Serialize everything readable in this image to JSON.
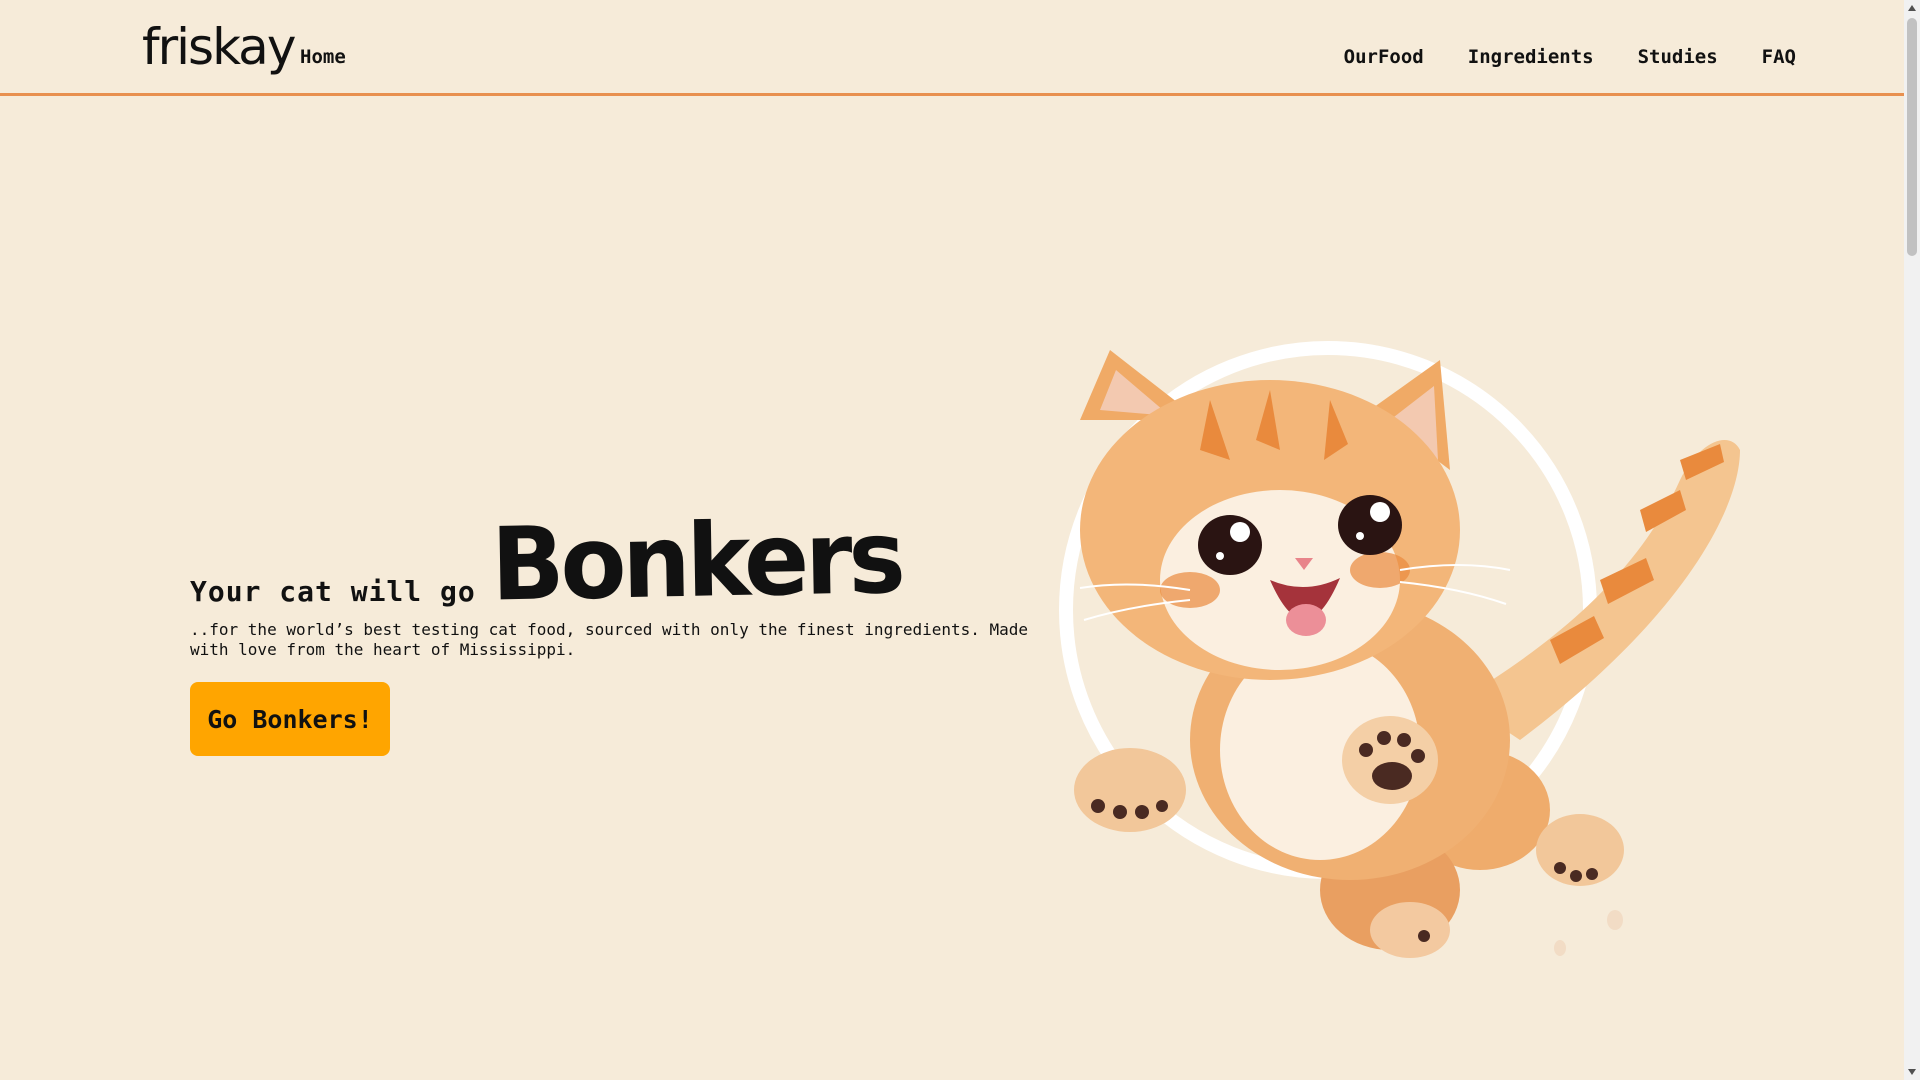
{
  "header": {
    "brand": "friskay",
    "home_label": "Home",
    "nav": [
      {
        "label": "OurFood"
      },
      {
        "label": "Ingredients"
      },
      {
        "label": "Studies"
      },
      {
        "label": "FAQ"
      }
    ]
  },
  "hero": {
    "lead": "Your cat will go",
    "highlight": "Bonkers",
    "tagline": "..for the world’s best testing cat food, sourced with only the finest ingredients. Made with love from the heart of Mississippi.",
    "cta_label": "Go Bonkers!"
  },
  "colors": {
    "background": "#f6ebd9",
    "header_border": "#e8904f",
    "cta": "#ffa500",
    "cat_fur": "#f2a866",
    "cat_stripes": "#e98a3d",
    "ring": "#ffffff"
  },
  "icons": {
    "illustration": "jumping-kitten-illustration",
    "scroll_up": "scroll-up-arrow-icon",
    "scroll_down": "scroll-down-arrow-icon"
  }
}
